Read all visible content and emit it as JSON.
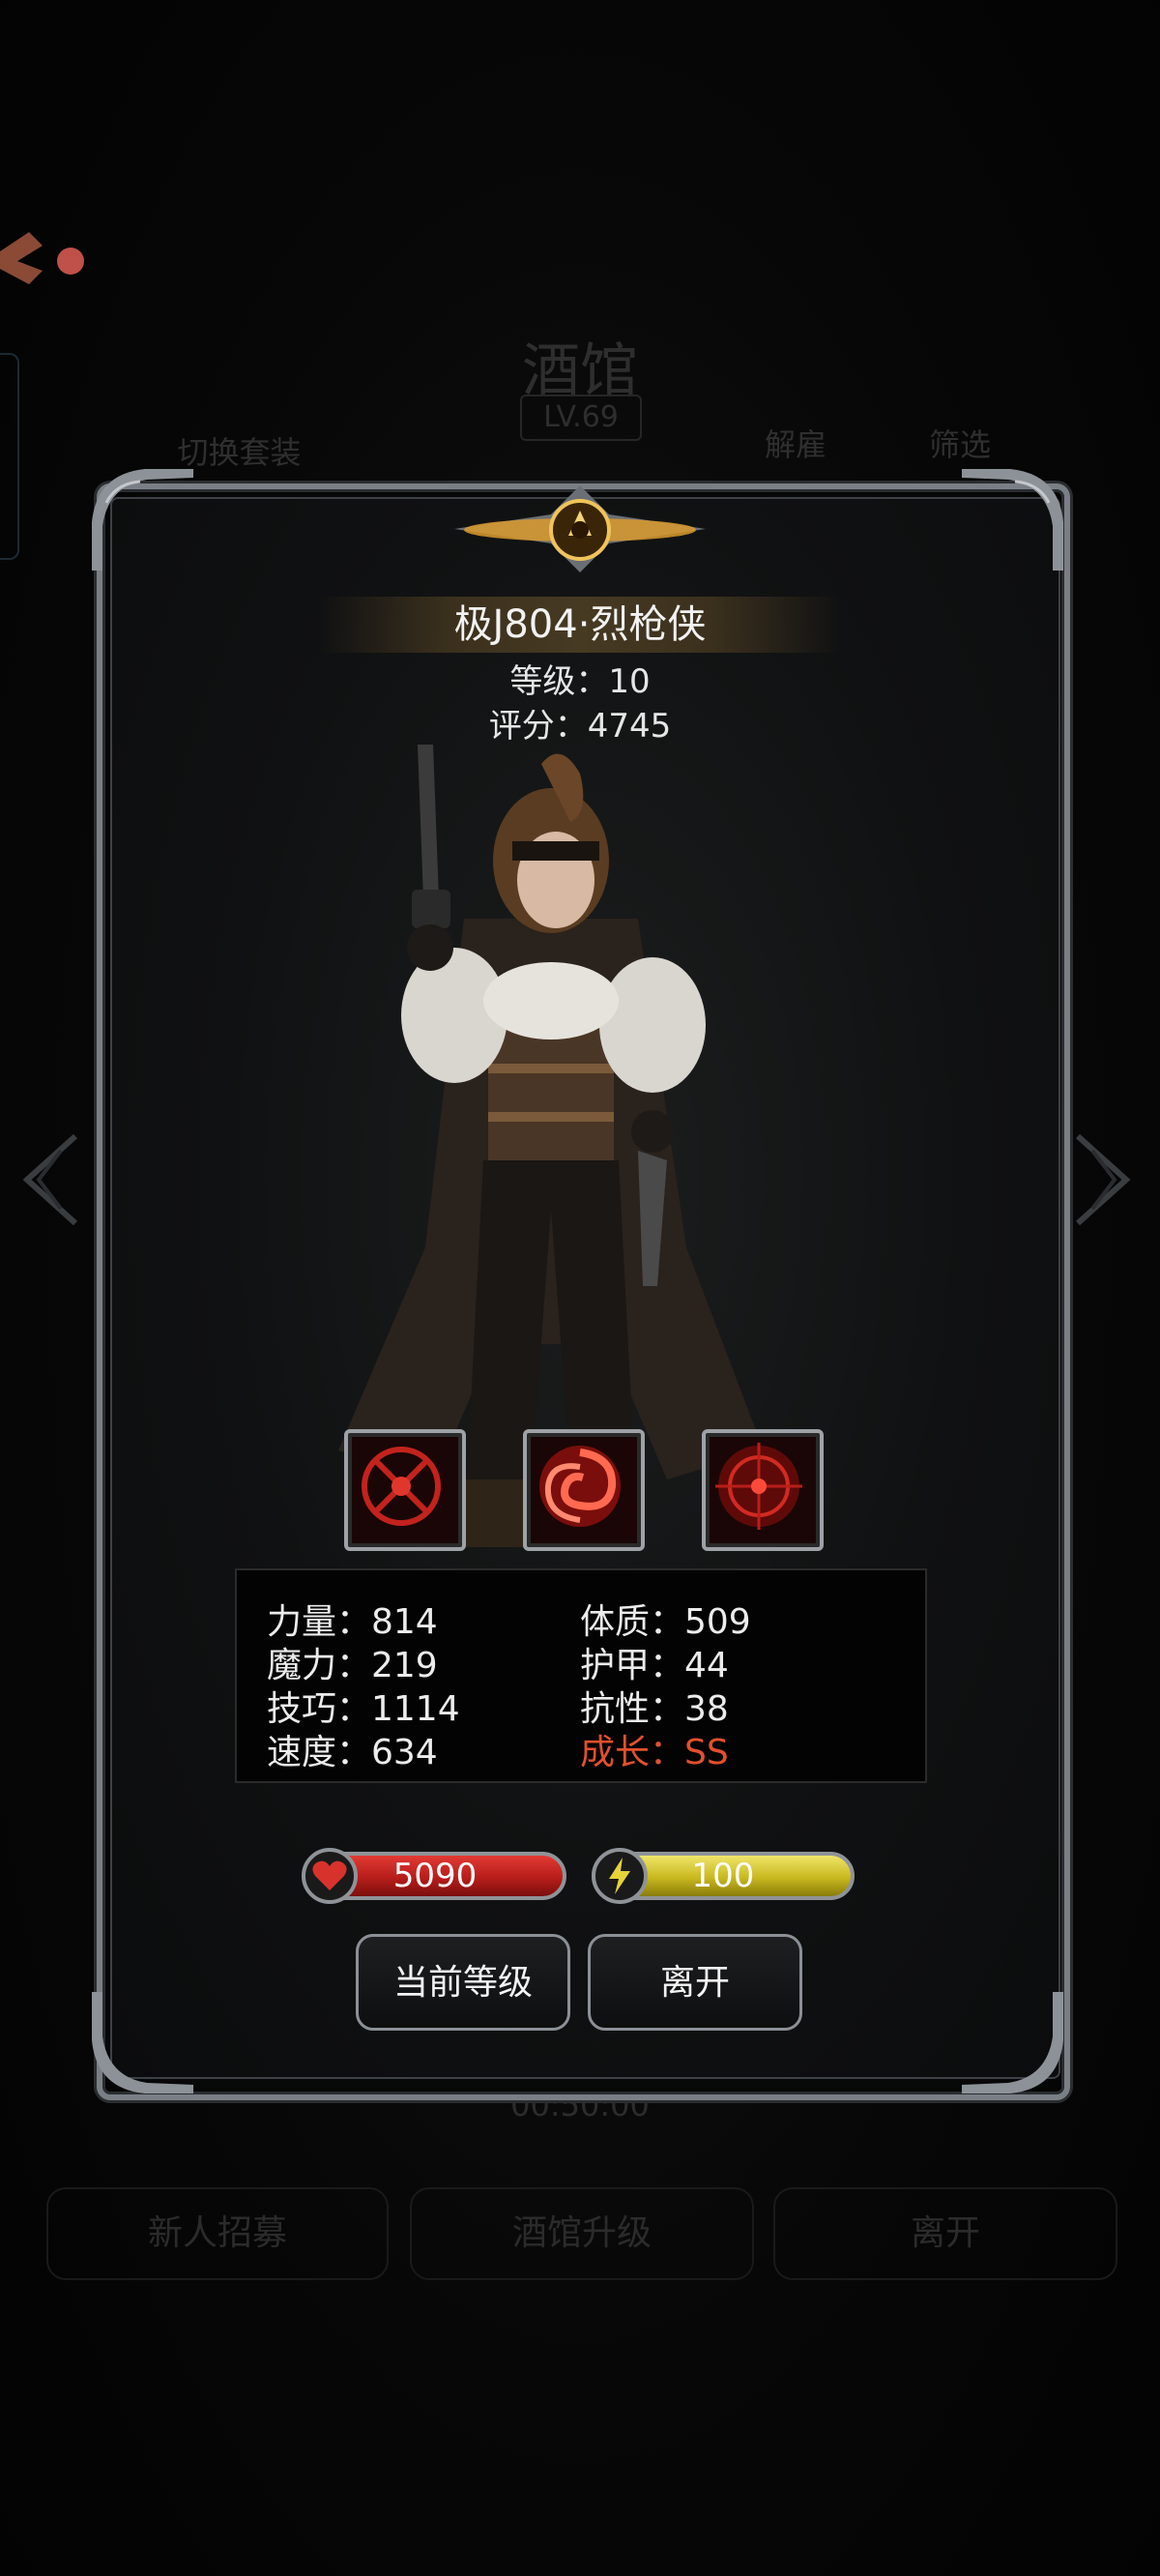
{
  "background": {
    "title": "酒馆",
    "level": "LV.69",
    "switch_outfit": "切换套装",
    "dismiss": "解雇",
    "filter": "筛选",
    "timer": "00:50:00",
    "bottom_buttons": [
      "新人招募",
      "酒馆升级",
      "离开"
    ]
  },
  "hero": {
    "name": "极J804·烈枪侠",
    "level_line": "等级：10",
    "score_line": "评分：4745"
  },
  "skills": [
    "crosshair-icon",
    "swirl-icon",
    "target-icon"
  ],
  "stats": {
    "strength": "力量：814",
    "magic": "魔力：219",
    "skill": "技巧：1114",
    "speed": "速度：634",
    "constitution": "体质：509",
    "armor": "护甲：44",
    "resistance": "抗性：38",
    "growth": "成长：SS"
  },
  "bars": {
    "hp": "5090",
    "energy": "100"
  },
  "buttons": {
    "current_level": "当前等级",
    "leave": "离开"
  },
  "colors": {
    "growth": "#e2502c",
    "hp_bar": "#c42421",
    "energy_bar": "#d6c62a"
  }
}
